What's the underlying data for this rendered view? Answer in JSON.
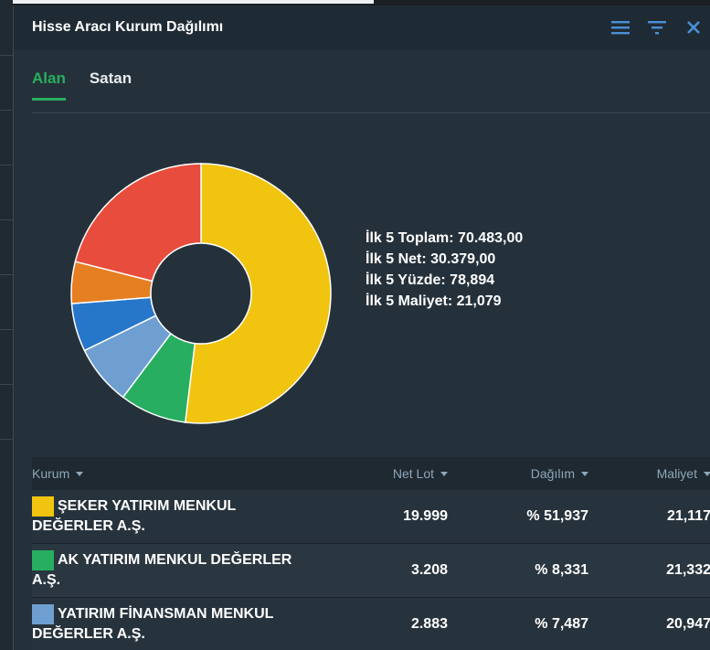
{
  "widget": {
    "title": "Hisse Aracı Kurum Dağılımı",
    "icons": [
      "menu-icon",
      "filter-icon",
      "close-icon"
    ]
  },
  "tabs": [
    {
      "label": "Alan",
      "active": true
    },
    {
      "label": "Satan",
      "active": false
    }
  ],
  "stats": {
    "total": "İlk 5 Toplam: 70.483,00",
    "net": "İlk 5 Net: 30.379,00",
    "percent": "İlk 5 Yüzde: 78,894",
    "cost": "İlk 5 Maliyet: 21,079"
  },
  "chart_data": {
    "type": "pie",
    "style": "donut",
    "values": [
      51.937,
      8.331,
      7.487,
      6.0,
      5.2,
      21.045
    ],
    "colors": [
      "#f1c40f",
      "#27ae60",
      "#6f9fd1",
      "#2677c9",
      "#e67e22",
      "#e74c3c"
    ]
  },
  "table": {
    "headers": {
      "name": "Kurum",
      "net": "Net Lot",
      "share": "Dağılım",
      "cost": "Maliyet"
    },
    "rows": [
      {
        "line1": "ŞEKER YATIRIM MENKUL",
        "line2": "DEĞERLER A.Ş.",
        "net": "19.999",
        "share": "% 51,937",
        "cost": "21,117",
        "color": "#f1c40f"
      },
      {
        "line1": "AK YATIRIM MENKUL DEĞERLER",
        "line2": "A.Ş.",
        "net": "3.208",
        "share": "% 8,331",
        "cost": "21,332",
        "color": "#27ae60"
      },
      {
        "line1": "YATIRIM FİNANSMAN MENKUL",
        "line2": "DEĞERLER A.Ş.",
        "net": "2.883",
        "share": "% 7,487",
        "cost": "20,947",
        "color": "#6f9fd1"
      }
    ]
  }
}
